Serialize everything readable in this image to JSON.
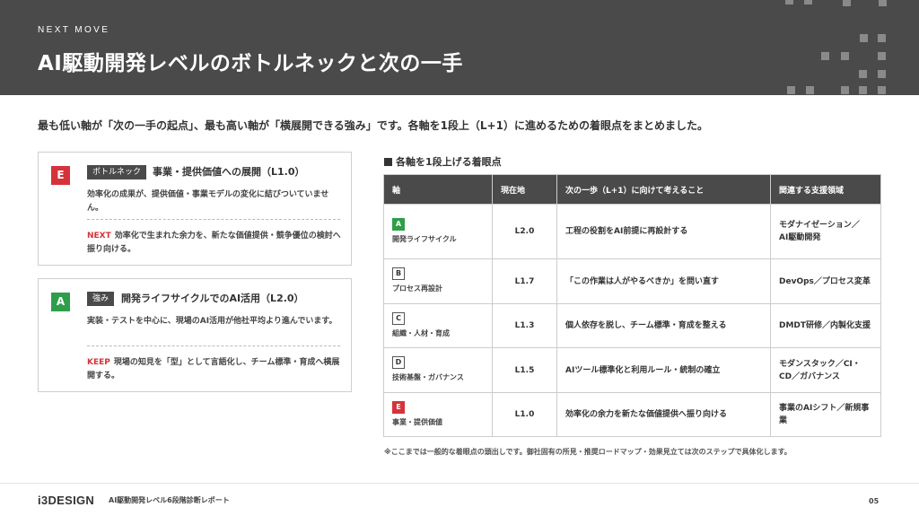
{
  "header": {
    "eyebrow": "NEXT MOVE",
    "title": "AI駆動開発レベルのボトルネックと次の一手"
  },
  "lead": "最も低い軸が「次の一手の起点」、最も高い軸が「横展開できる強み」です。各軸を1段上（L+1）に進めるための着眼点をまとめました。",
  "cards": [
    {
      "badge": "E",
      "badge_color": "#d6323a",
      "tag": "ボトルネック",
      "title": "事業・提供価値への展開（L1.0）",
      "desc": "効率化の成果が、提供価値・事業モデルの変化に結びついていません。",
      "action_label": "NEXT",
      "action_text": "効率化で生まれた余力を、新たな価値提供・競争優位の検討へ振り向ける。"
    },
    {
      "badge": "A",
      "badge_color": "#2e9e4a",
      "tag": "強み",
      "title": "開発ライフサイクルでのAI活用（L2.0）",
      "desc": "実装・テストを中心に、現場のAI活用が他社平均より進んでいます。",
      "action_label": "KEEP",
      "action_text": "現場の知見を「型」として言語化し、チーム標準・育成へ横展開する。"
    }
  ],
  "section_title": "各軸を1段上げる着眼点",
  "table": {
    "headers": [
      "軸",
      "現在地",
      "次の一歩（L+1）に向けて考えること",
      "関連する支援領域"
    ],
    "rows": [
      {
        "badge": "A",
        "badge_style": "green",
        "axis": "開発ライフサイクル",
        "current": "L2.0",
        "next": "工程の役割をAI前提に再設計する",
        "support": "モダナイゼーション／AI駆動開発"
      },
      {
        "badge": "B",
        "badge_style": "outline",
        "axis": "プロセス再設計",
        "current": "L1.7",
        "next": "「この作業は人がやるべきか」を問い直す",
        "support": "DevOps／プロセス変革"
      },
      {
        "badge": "C",
        "badge_style": "outline",
        "axis": "組織・人材・育成",
        "current": "L1.3",
        "next": "個人依存を脱し、チーム標準・育成を整える",
        "support": "DMDT研修／内製化支援"
      },
      {
        "badge": "D",
        "badge_style": "outline",
        "axis": "技術基盤・ガバナンス",
        "current": "L1.5",
        "next": "AIツール標準化と利用ルール・統制の確立",
        "support": "モダンスタック／CI・CD／ガバナンス"
      },
      {
        "badge": "E",
        "badge_style": "red",
        "axis": "事業・提供価値",
        "current": "L1.0",
        "next": "効率化の余力を新たな価値提供へ振り向ける",
        "support": "事業のAIシフト／新規事業"
      }
    ]
  },
  "note": "※ここまでは一般的な着眼点の頭出しです。御社固有の所見・推奨ロードマップ・効果見立ては次のステップで具体化します。",
  "footer": {
    "logo": "i3DESIGN",
    "report": "AI駆動開発レベル6段階診断レポート",
    "page": "05"
  },
  "colors": {
    "header_bg": "#4a4a4a",
    "accent_red": "#d6323a",
    "accent_green": "#2e9e4a"
  }
}
